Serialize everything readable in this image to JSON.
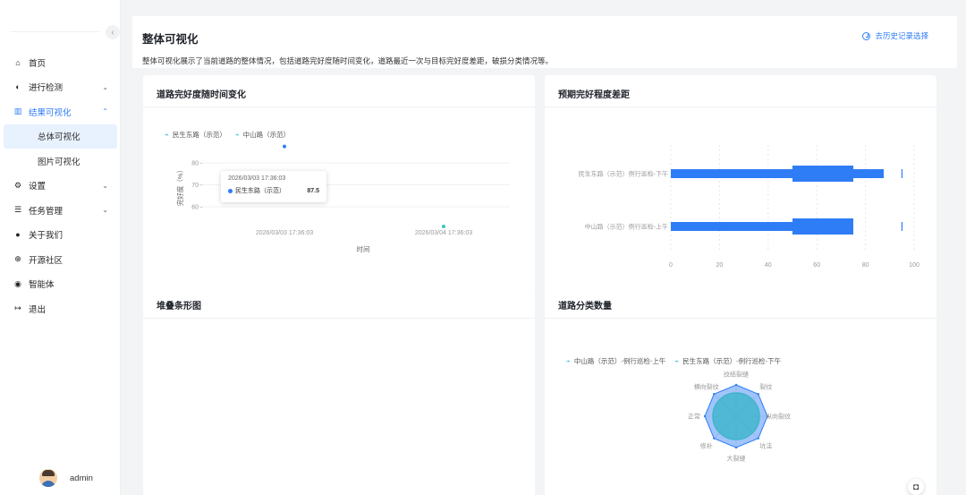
{
  "sidebar": {
    "menu": [
      {
        "icon": "home-icon",
        "glyph": "⌂",
        "label": "首页"
      },
      {
        "icon": "detect-icon",
        "glyph": "◐",
        "label": "进行检测"
      },
      {
        "icon": "chart-icon",
        "glyph": "▥",
        "label": "结果可视化"
      },
      {
        "icon": "gear-icon",
        "glyph": "⚙",
        "label": "设置"
      },
      {
        "icon": "task-icon",
        "glyph": "☰",
        "label": "任务管理"
      },
      {
        "icon": "info-icon",
        "glyph": "●",
        "label": "关于我们"
      },
      {
        "icon": "globe-icon",
        "glyph": "⊕",
        "label": "开源社区"
      },
      {
        "icon": "robot-icon",
        "glyph": "◉",
        "label": "智能体"
      },
      {
        "icon": "logout-icon",
        "glyph": "↦",
        "label": "退出"
      }
    ],
    "submenu": [
      "总体可视化",
      "图片可视化"
    ],
    "collapse_glyph": "‹",
    "user_name": "admin"
  },
  "header": {
    "title": "整体可视化",
    "description": "整体可视化展示了当前道路的整体情况，包括道路完好度随时间变化，道路最近一次与目标完好度差距，破损分类情况等。",
    "history_link": "去历史记录选择"
  },
  "cards": {
    "c1_title": "道路完好度随时间变化",
    "c2_title": "预期完好程度差距",
    "c3_title": "堆叠条形图",
    "c4_title": "道路分类数量"
  },
  "tooltip": {
    "time": "2026/03/03 17:36:03",
    "series": "民生东路（示范）",
    "value": "87.5"
  },
  "chart_data": [
    {
      "type": "scatter",
      "title": "道路完好度随时间变化",
      "xlabel": "时间",
      "ylabel": "完好度（%）",
      "yticks": [
        60,
        70,
        80
      ],
      "x_ticks": [
        "2026/03/03 17:36:03",
        "2026/03/04 17:36:03"
      ],
      "series": [
        {
          "name": "民生东路（示范）",
          "color": "#2f7df6",
          "points": [
            {
              "x": "2026/03/03 17:36:03",
              "y": 87.5
            }
          ]
        },
        {
          "name": "中山路（示范）",
          "color": "#36c7c0",
          "points": [
            {
              "x": "2026/03/04 17:36:03",
              "y": 51
            }
          ]
        }
      ]
    },
    {
      "type": "bar",
      "title": "预期完好程度差距",
      "orientation": "horizontal",
      "categories": [
        "民生东路（示范）例行巡检-下午",
        "中山路（示范）例行巡检-上午"
      ],
      "xlim": [
        0,
        100
      ],
      "xticks": [
        0,
        20,
        40,
        60,
        80,
        100
      ],
      "color": "#2f7df6",
      "bars": [
        {
          "value": 87.5,
          "band_range": [
            50,
            75
          ],
          "target": 95
        },
        {
          "value": 75,
          "band_range": [
            50,
            75
          ],
          "target": 95
        }
      ]
    },
    {
      "type": "bar",
      "title": "堆叠条形图",
      "series": []
    },
    {
      "type": "radar",
      "title": "道路分类数量",
      "indicators": [
        "纹结裂缝",
        "裂纹",
        "纵向裂纹",
        "坑洼",
        "大裂缝",
        "修补",
        "正常",
        "横向裂纹"
      ],
      "series": [
        {
          "name": "中山路（示范）-例行巡检-上午",
          "color": "#36b3c7",
          "values": [
            0.75,
            0.75,
            0.75,
            0.75,
            0.75,
            0.75,
            0.75,
            0.75
          ]
        },
        {
          "name": "民生东路（示范）-例行巡检-下午",
          "color": "#2f7df6",
          "values": [
            1,
            1,
            1,
            1,
            1,
            1,
            1,
            1
          ]
        }
      ]
    }
  ]
}
